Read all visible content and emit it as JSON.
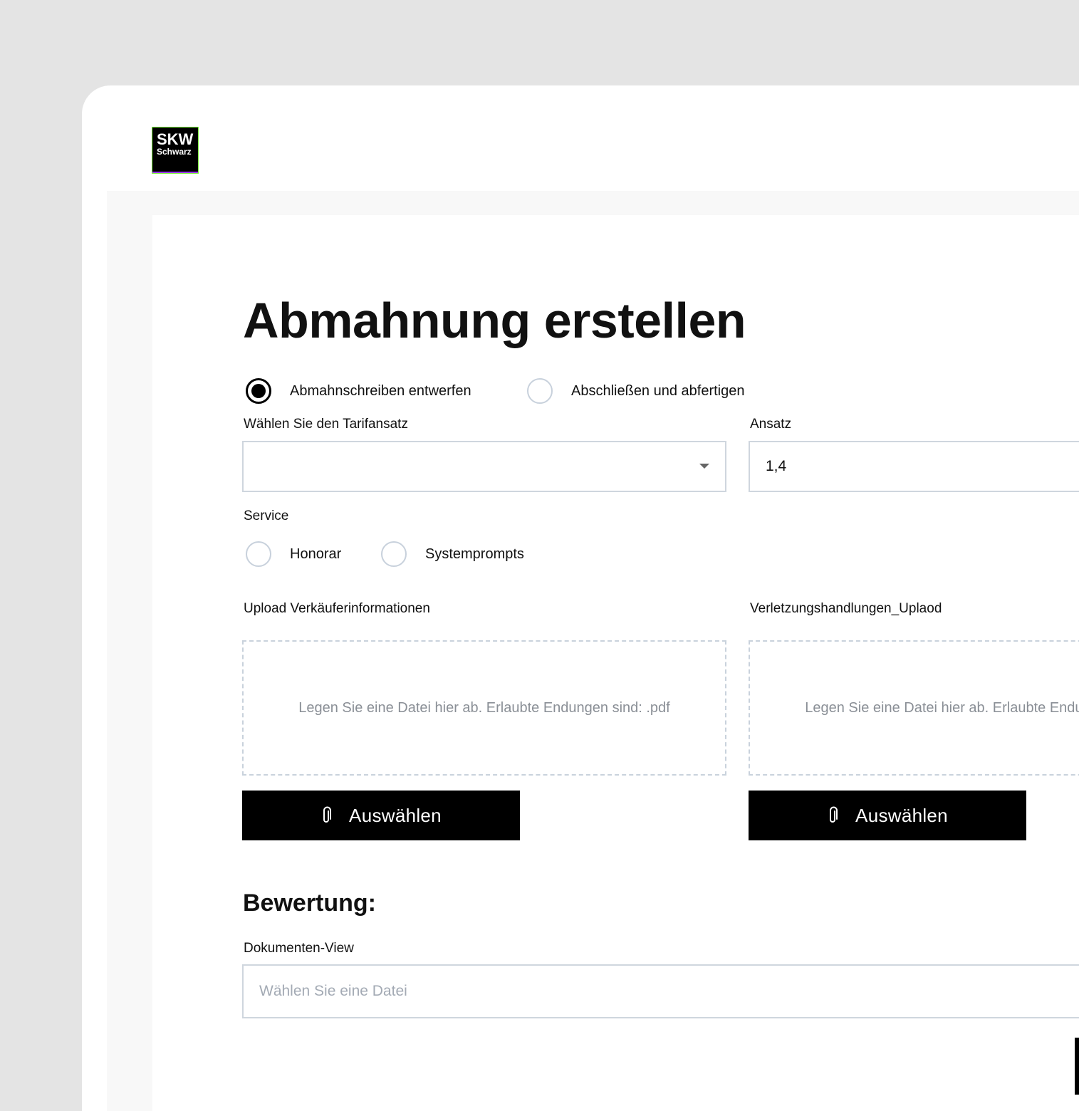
{
  "brand": {
    "logo_line1": "SKW",
    "logo_line2": "Schwarz"
  },
  "page": {
    "title": "Abmahnung erstellen"
  },
  "mode": {
    "options": [
      {
        "label": "Abmahnschreiben entwerfen",
        "selected": true
      },
      {
        "label": "Abschließen und abfertigen",
        "selected": false
      }
    ]
  },
  "tarif": {
    "label": "Wählen Sie den Tarifansatz",
    "value": ""
  },
  "ansatz": {
    "label": "Ansatz",
    "value": "1,4"
  },
  "service": {
    "label": "Service",
    "options": [
      {
        "label": "Honorar",
        "selected": false
      },
      {
        "label": "Systemprompts",
        "selected": false
      }
    ]
  },
  "upload_seller": {
    "label": "Upload Verkäuferinformationen",
    "hint": "Legen Sie eine Datei hier ab. Erlaubte Endungen sind: .pdf",
    "button": "Auswählen"
  },
  "upload_violations": {
    "label": "Verletzungshandlungen_Uplaod",
    "hint": "Legen Sie eine Datei hier ab. Erlaubte Endungen sind: .pdf",
    "button": "Auswählen"
  },
  "rating": {
    "heading": "Bewertung:",
    "docview_label": "Dokumenten-View",
    "docview_placeholder": "Wählen Sie eine Datei"
  },
  "colors": {
    "accent": "#000000",
    "border": "#cfd6de",
    "background": "#e4e4e4"
  }
}
